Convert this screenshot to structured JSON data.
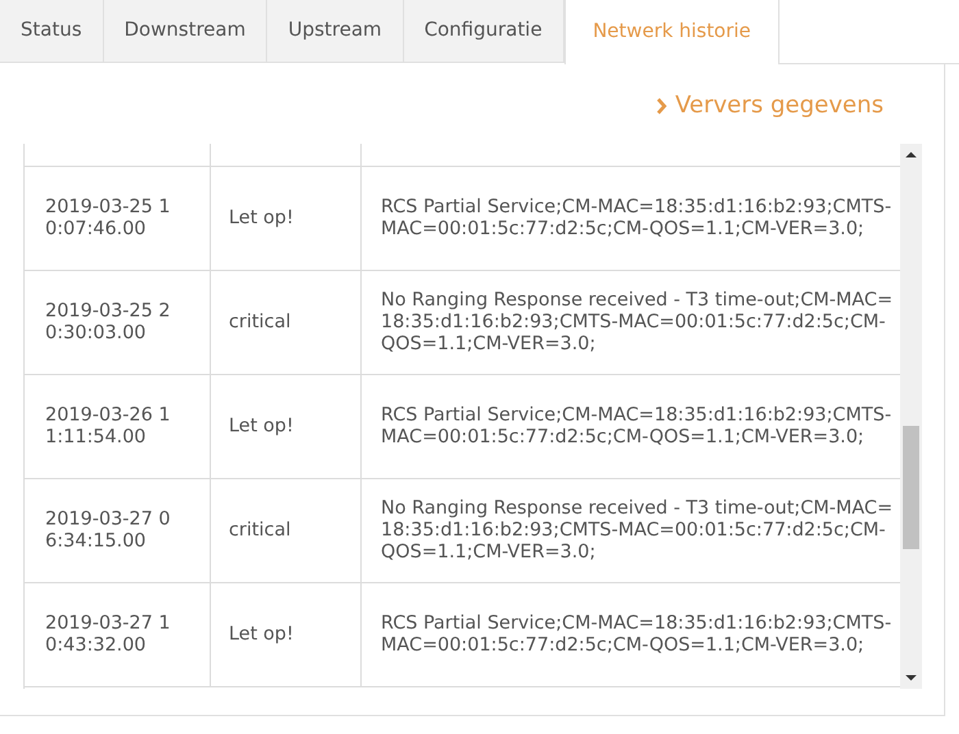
{
  "tabs": [
    {
      "label": "Status",
      "selected": false
    },
    {
      "label": "Downstream",
      "selected": false
    },
    {
      "label": "Upstream",
      "selected": false
    },
    {
      "label": "Configuratie",
      "selected": false
    },
    {
      "label": "Netwerk historie",
      "selected": true
    }
  ],
  "refresh_link": "Ververs gegevens",
  "table": {
    "rows": [
      {
        "time": "2019-03-25 10:07:46.00",
        "level": "Let op!",
        "message": "RCS Partial Service;CM-MAC=18:35:d1:16:b2:93;CMTS-MAC=00:01:5c:77:d2:5c;CM-QOS=1.1;CM-VER=3.0;"
      },
      {
        "time": "2019-03-25 20:30:03.00",
        "level": "critical",
        "message": "No Ranging Response received - T3 time-out;CM-MAC=18:35:d1:16:b2:93;CMTS-MAC=00:01:5c:77:d2:5c;CM-QOS=1.1;CM-VER=3.0;"
      },
      {
        "time": "2019-03-26 11:11:54.00",
        "level": "Let op!",
        "message": "RCS Partial Service;CM-MAC=18:35:d1:16:b2:93;CMTS-MAC=00:01:5c:77:d2:5c;CM-QOS=1.1;CM-VER=3.0;"
      },
      {
        "time": "2019-03-27 06:34:15.00",
        "level": "critical",
        "message": "No Ranging Response received - T3 time-out;CM-MAC=18:35:d1:16:b2:93;CMTS-MAC=00:01:5c:77:d2:5c;CM-QOS=1.1;CM-VER=3.0;"
      },
      {
        "time": "2019-03-27 10:43:32.00",
        "level": "Let op!",
        "message": "RCS Partial Service;CM-MAC=18:35:d1:16:b2:93;CMTS-MAC=00:01:5c:77:d2:5c;CM-QOS=1.1;CM-VER=3.0;"
      }
    ]
  }
}
